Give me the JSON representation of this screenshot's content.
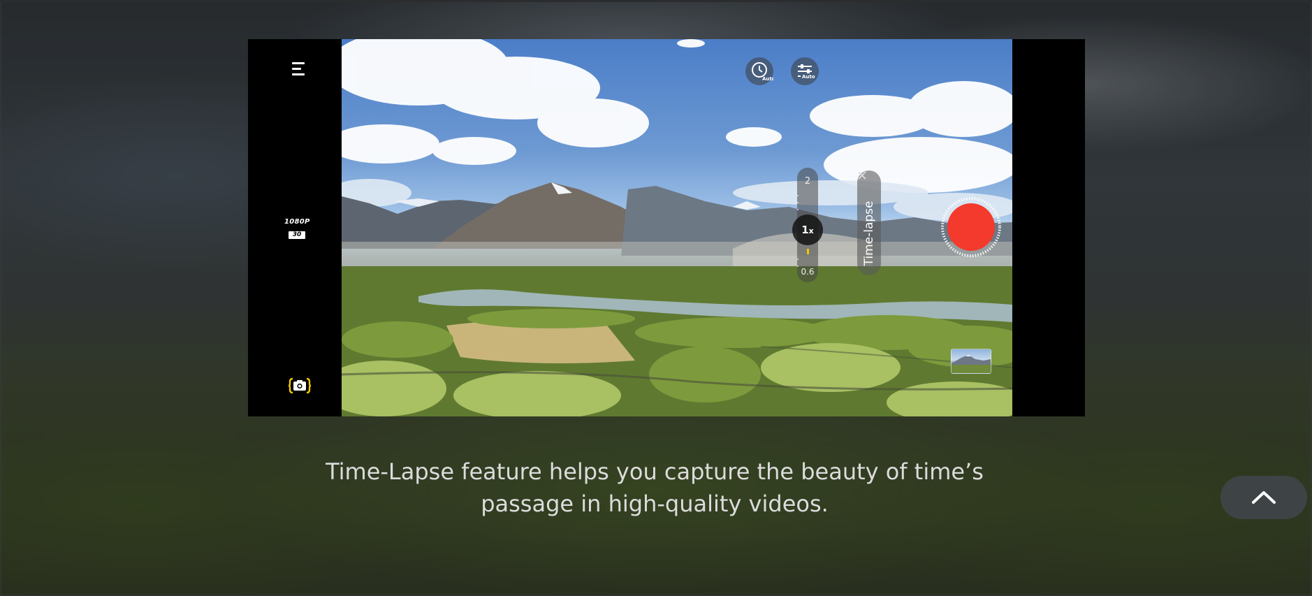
{
  "camera": {
    "resolution_label": "1080P",
    "fps_label": "30",
    "zoom_max_label": "2",
    "zoom_current_label": "1",
    "zoom_unit": "x",
    "zoom_min_label": "0.6",
    "mode_label": "Time-lapse",
    "timer_icon_text": "Auto",
    "adjust_icon_text": "Auto",
    "record_color": "#f33a2c",
    "accent_color": "#f2c600"
  },
  "caption": {
    "line1": "Time-Lapse feature helps you capture the beauty of time’s",
    "line2": "passage in high-quality videos."
  },
  "icons": {
    "menu": "menu-icon",
    "timer": "timer-auto-icon",
    "adjust": "adjust-auto-icon",
    "camera_switch": "camera-switch-icon",
    "close": "close-icon",
    "scroll_top": "chevron-up-icon"
  }
}
